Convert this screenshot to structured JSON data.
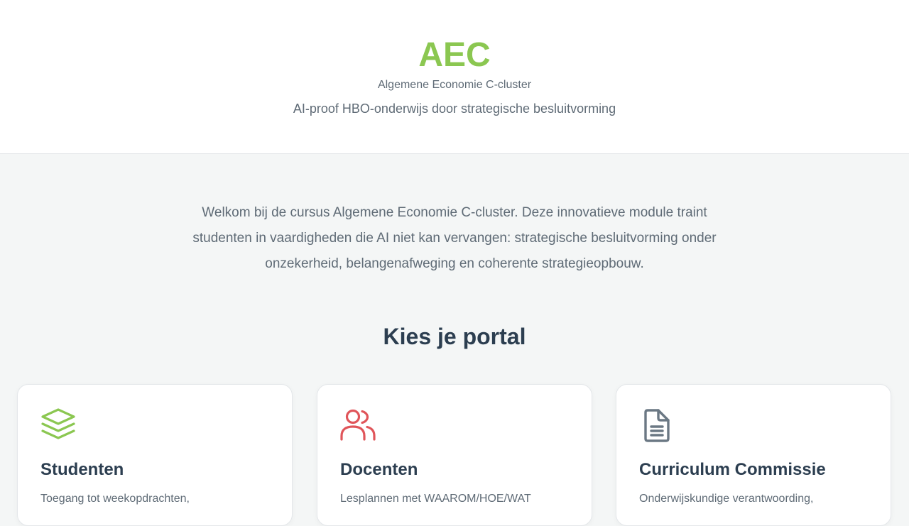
{
  "header": {
    "brand": "AEC",
    "subtitle": "Algemene Economie C-cluster",
    "tagline": "AI-proof HBO-onderwijs door strategische besluitvorming"
  },
  "intro": "Welkom bij de cursus Algemene Economie C-cluster. Deze innovatieve module traint studenten in vaardigheden die AI niet kan vervangen: strategische besluitvorming onder onzekerheid, belangenafweging en coherente strategieopbouw.",
  "portal_section": {
    "title": "Kies je portal",
    "cards": [
      {
        "title": "Studenten",
        "description": "Toegang tot weekopdrachten,",
        "icon": "layers-icon",
        "color": "#8bc751"
      },
      {
        "title": "Docenten",
        "description": "Lesplannen met WAAROM/HOE/WAT",
        "icon": "users-icon",
        "color": "#e0555a"
      },
      {
        "title": "Curriculum Commissie",
        "description": "Onderwijskundige verantwoording,",
        "icon": "document-icon",
        "color": "#6b7884"
      }
    ]
  },
  "colors": {
    "brand": "#8bc751",
    "text_primary": "#2c3e50",
    "text_secondary": "#5f6b76",
    "background": "#f4f6f6"
  }
}
